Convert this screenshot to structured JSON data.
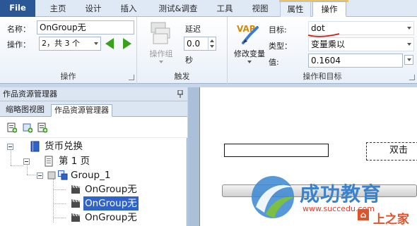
{
  "tabs": {
    "file": "File",
    "home": "主页",
    "design": "设计",
    "insert": "插入",
    "test": "测试&调查",
    "tools": "工具",
    "view": "视图",
    "attributes": "属性",
    "actions": "操作"
  },
  "ribbon": {
    "action_group": {
      "name_label": "名称：",
      "name_value": "OnGroup无",
      "action_label": "操作：",
      "action_value": "2，共 3 个",
      "group_label": "操作"
    },
    "trigger_group": {
      "action_group_btn": "操作组",
      "delay_label": "延迟",
      "delay_value": "0.0",
      "seconds_label": "秒",
      "group_label": "触发"
    },
    "target_group": {
      "var_icon_text": "VAR",
      "modify_var_btn": "修改变量",
      "target_label": "目标:",
      "target_value": "dot",
      "type_label": "类型：",
      "type_value": "变量乘以",
      "value_label": "值:",
      "value_value": "0.1604",
      "group_label": "操作和目标"
    }
  },
  "left_pane": {
    "title": "作品资源管理器",
    "tabs": [
      "缩略图视图",
      "作品资源管理器"
    ],
    "tree": {
      "root": "货币兑换",
      "page": "第 1 页",
      "group": "Group_1",
      "items": [
        "OnGroup无",
        "OnGroup无",
        "OnGroup无"
      ]
    }
  },
  "canvas": {
    "button_text": "双击"
  },
  "watermark": {
    "brand": "成功教育",
    "url": "www.succedu.com",
    "corner": "上之家"
  },
  "colors": {
    "file_tab": "#2b5797",
    "selection": "#2f63c9",
    "annotation_red": "#d0201a",
    "nav_arrow_green": "#3aa01d"
  }
}
